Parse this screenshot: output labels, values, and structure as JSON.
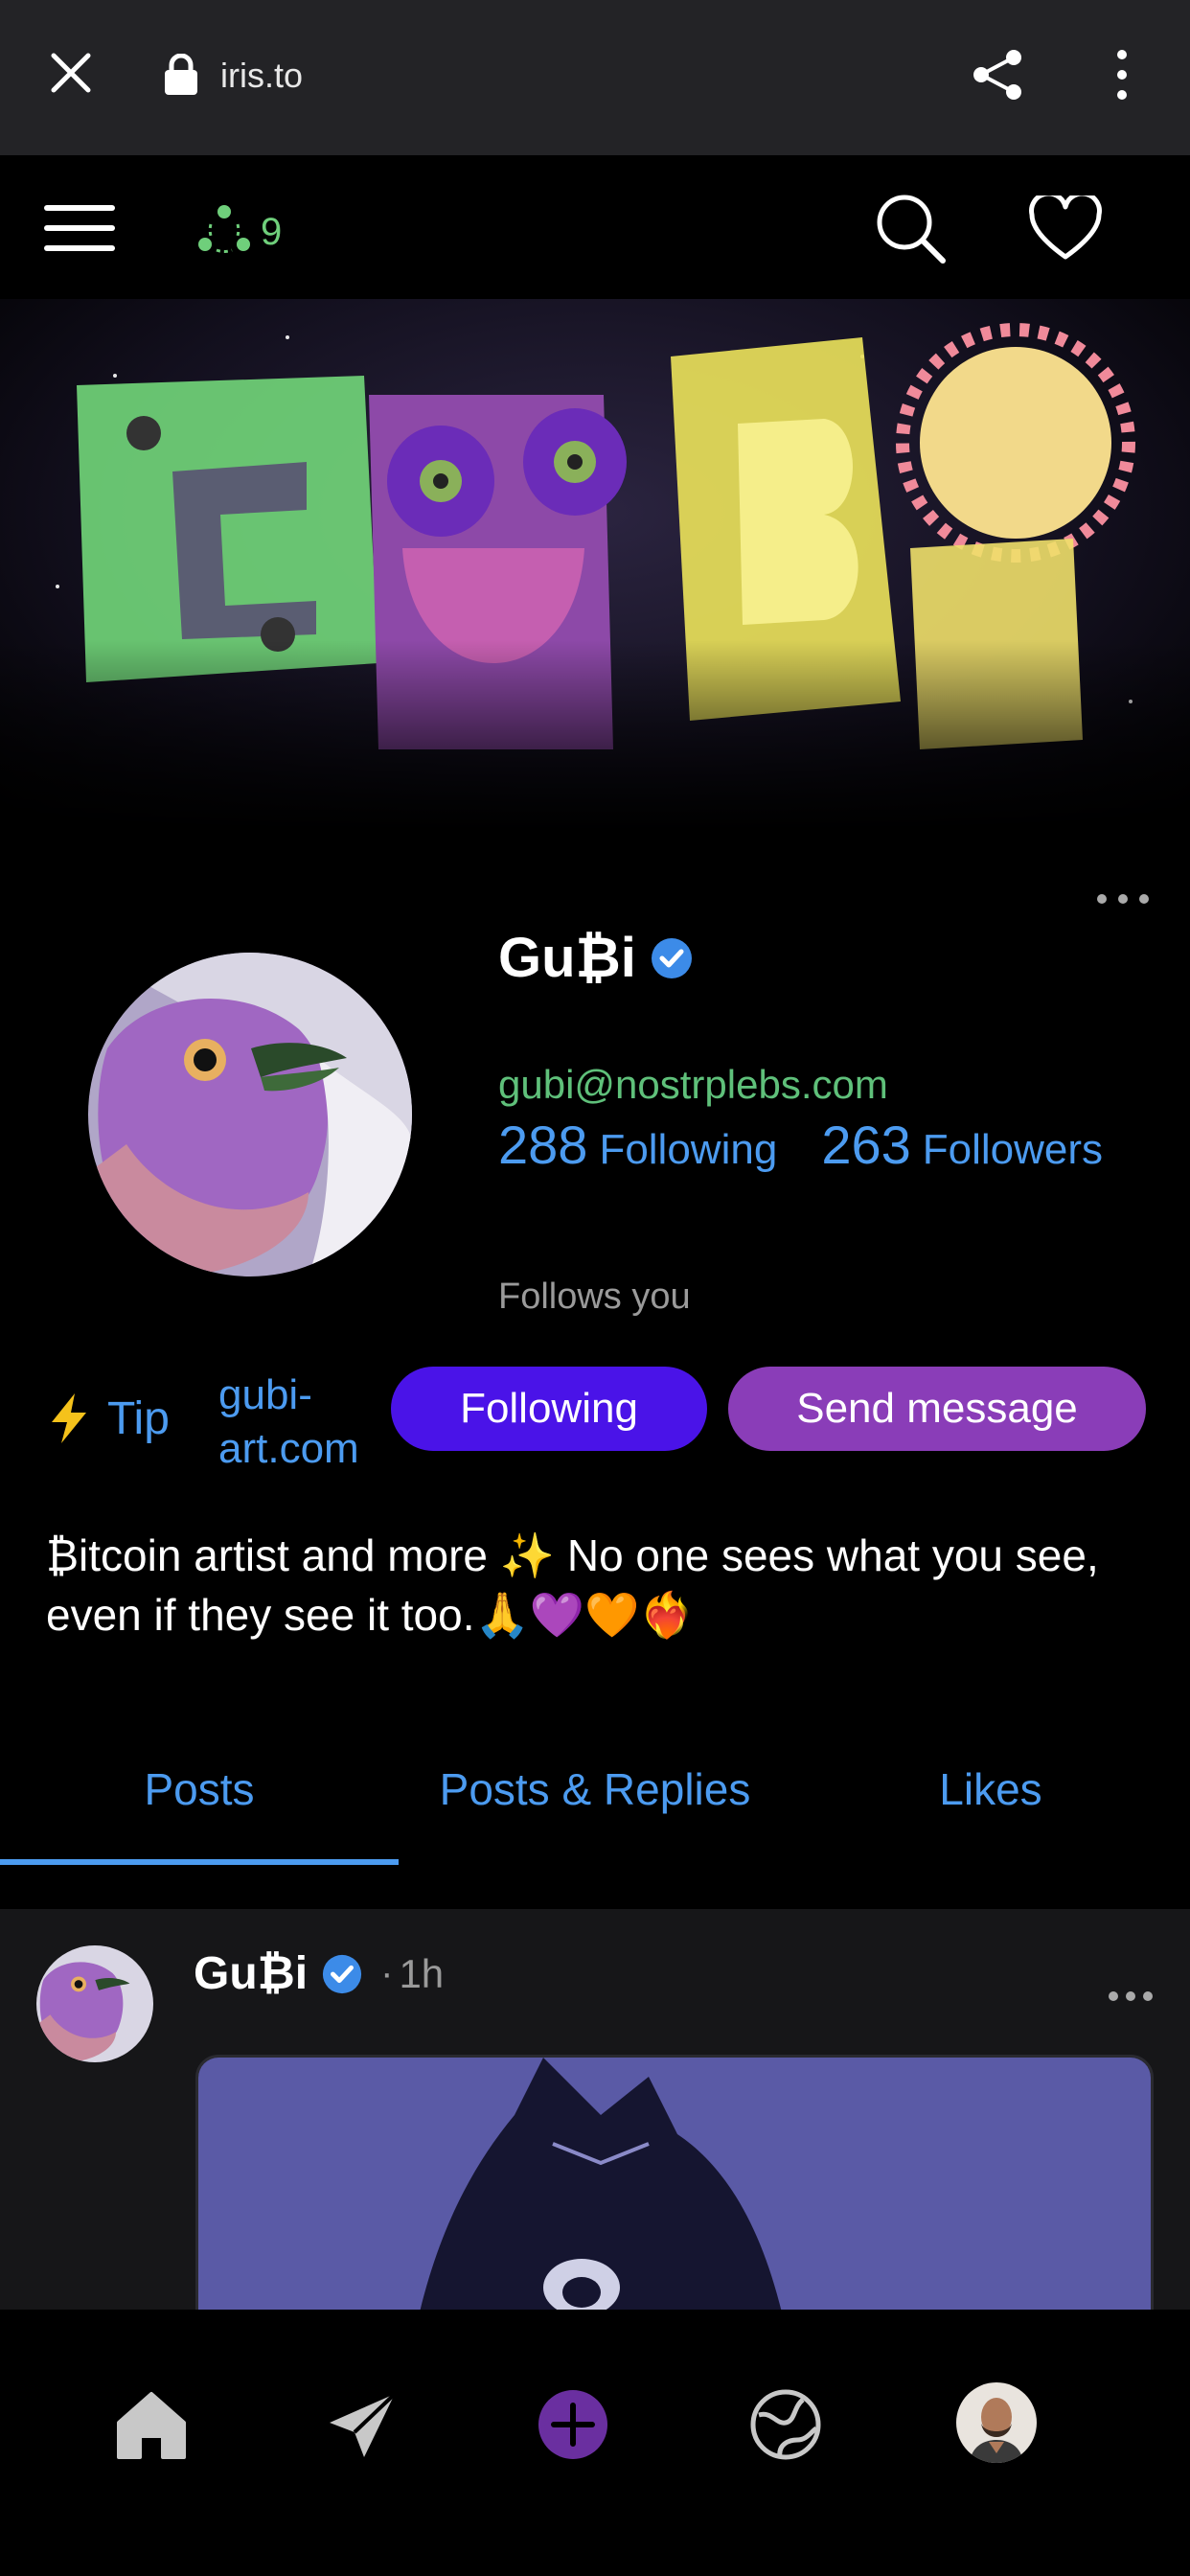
{
  "browser": {
    "url": "iris.to",
    "icons": [
      "close-icon",
      "lock-icon",
      "share-icon",
      "more-vertical-icon"
    ]
  },
  "header": {
    "relay_count": "9",
    "icons": [
      "menu-icon",
      "relays-icon",
      "search-icon",
      "heart-icon"
    ]
  },
  "profile": {
    "name": "Gu₿i",
    "nip05": "gubi@nostrplebs.com",
    "following_count": "288",
    "following_label": "Following",
    "followers_count": "263",
    "followers_label": "Followers",
    "follows_you": "Follows you",
    "tip_label": "Tip",
    "website": "gubi-art.com",
    "follow_button": "Following",
    "message_button": "Send message",
    "bio": "₿itcoin artist and more ✨ No one sees what you see, even if they see it too.🙏💜🧡❤️‍🔥"
  },
  "tabs": {
    "posts": "Posts",
    "replies": "Posts & Replies",
    "likes": "Likes",
    "active": "posts"
  },
  "post": {
    "author": "Gu₿i",
    "separator": "·",
    "time": "1h"
  },
  "bottom_nav": {
    "items": [
      "home-icon",
      "send-icon",
      "new-post-icon",
      "globe-icon",
      "user-avatar"
    ]
  },
  "colors": {
    "accent_blue": "#4c9bf0",
    "nip05_green": "#5fc07a",
    "follow_button": "#4a13e8",
    "message_button": "#8a3db8",
    "browser_bar": "#232326"
  }
}
